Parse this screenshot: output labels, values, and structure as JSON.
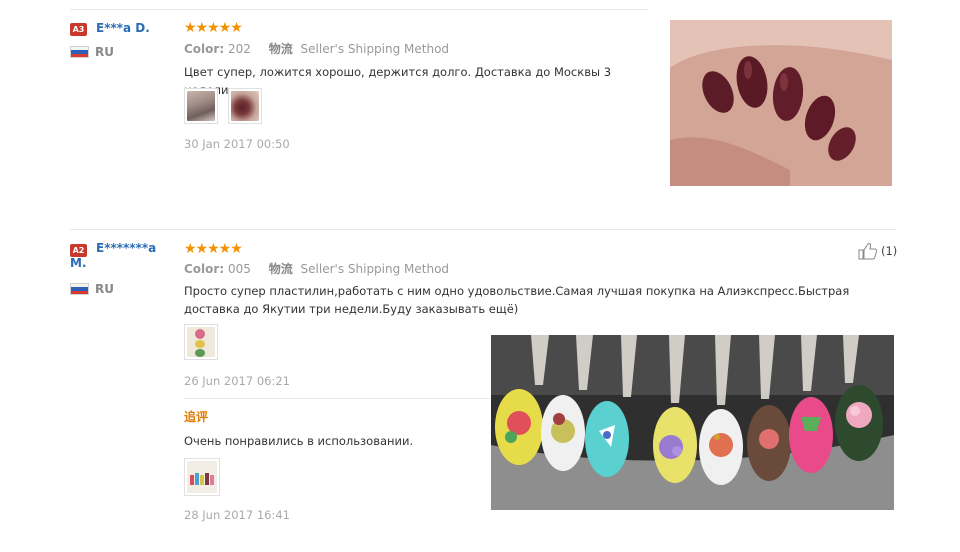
{
  "reviews": [
    {
      "badge": "A3",
      "user": "E***a D.",
      "country": "RU",
      "stars": "★★★★★",
      "color_label": "Color:",
      "color_value": "202",
      "shipping_cn": "物流",
      "shipping": "Seller's Shipping Method",
      "text": "Цвет супер, ложится хорошо, держится долго. Доставка до Москвы 3 недели.",
      "date": "30 Jan 2017 00:50"
    },
    {
      "badge": "A2",
      "user": "E*******a M.",
      "country": "RU",
      "stars": "★★★★★",
      "color_label": "Color:",
      "color_value": "005",
      "shipping_cn": "物流",
      "shipping": "Seller's Shipping Method",
      "text": "Просто супер пластилин,работать с ним одно удовольствие.Самая лучшая покупка на Алиэкспресс.Быстрая доставка до Якутии три недели.Буду заказывать ещё)",
      "date": "26 Jun 2017 06:21",
      "helpful": "(1)",
      "additional": {
        "label": "追评",
        "text": "Очень понравились в использовании.",
        "date": "28 Jun 2017 16:41"
      }
    }
  ],
  "colors": {
    "star": "#f29200",
    "username": "#2b6cb5",
    "badge": "#c8392b",
    "additional_label": "#e07a00"
  }
}
